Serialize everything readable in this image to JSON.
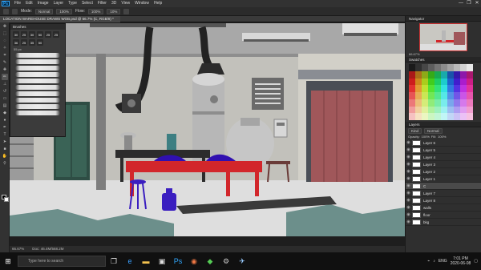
{
  "menubar": {
    "app_logo": "Ps",
    "items": [
      "File",
      "Edit",
      "Image",
      "Layer",
      "Type",
      "Select",
      "Filter",
      "3D",
      "View",
      "Window",
      "Help"
    ],
    "window_controls": [
      "—",
      "❐",
      "✕"
    ]
  },
  "options_bar": {
    "mode": "Mode:",
    "mode_value": "Normal",
    "opacity": "100%",
    "flow": "Flow:",
    "flow_value": "100%",
    "smoothing": "10%"
  },
  "document_tab": {
    "title": "LOCATION WAREHOUSE DRAWS WOB.psd @ 66.7% (C, RGB/8) *"
  },
  "brushes_panel": {
    "title": "Brushes",
    "sizes": [
      "30",
      "25",
      "30",
      "50",
      "25",
      "25",
      "36",
      "25",
      "35",
      "50"
    ],
    "preview_size": "55 px",
    "strokes": 10
  },
  "right_panels": {
    "navigator_title": "Navigator",
    "zoom": "66.67%",
    "swatches_title": "Swatches",
    "layers_title": "Layers",
    "layer_filter": "Kind",
    "blend_mode": "Normal",
    "opacity_label": "Opacity:",
    "opacity_value": "100%",
    "fill_label": "Fill:",
    "fill_value": "100%",
    "layers": [
      {
        "name": "Layer 6",
        "selected": false
      },
      {
        "name": "Layer 5",
        "selected": false
      },
      {
        "name": "Layer 4",
        "selected": false
      },
      {
        "name": "Layer 3",
        "selected": false
      },
      {
        "name": "Layer 2",
        "selected": false
      },
      {
        "name": "Layer 1",
        "selected": false
      },
      {
        "name": "C",
        "selected": true
      },
      {
        "name": "Layer 7",
        "selected": false
      },
      {
        "name": "Layer 8",
        "selected": false
      },
      {
        "name": "walls",
        "selected": false
      },
      {
        "name": "floor",
        "selected": false
      },
      {
        "name": "bkg",
        "selected": false
      }
    ]
  },
  "status": {
    "zoom": "66.67%",
    "doc": "Doc: 46.4M/568.2M"
  },
  "taskbar": {
    "search_placeholder": "Type here to search",
    "time": "7:01 PM",
    "date": "2020-06-08",
    "lang": "ENG"
  }
}
